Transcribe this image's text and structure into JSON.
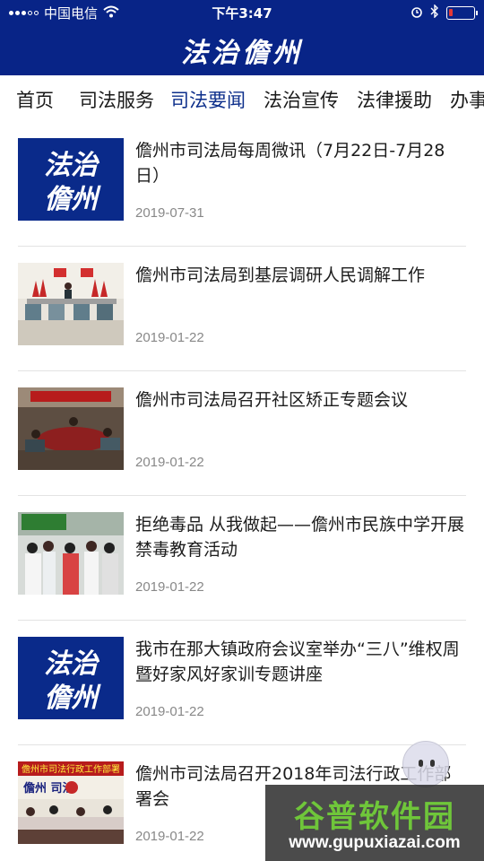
{
  "status_bar": {
    "carrier": "中国电信",
    "time": "下午3:47",
    "battery_level": 0.15,
    "battery_color": "#e53935"
  },
  "header": {
    "title": "法治儋州",
    "background_color": "#082487"
  },
  "tabs": [
    {
      "label": "首页",
      "active": false
    },
    {
      "label": "司法服务",
      "active": false
    },
    {
      "label": "司法要闻",
      "active": true
    },
    {
      "label": "法治宣传",
      "active": false
    },
    {
      "label": "法律援助",
      "active": false
    },
    {
      "label": "办事",
      "active": false
    }
  ],
  "accent_color": "#0d2f8b",
  "news": [
    {
      "title": "儋州市司法局每周微讯（7月22日-7月28日）",
      "date": "2019-07-31",
      "thumb": "logo"
    },
    {
      "title": "儋州市司法局到基层调研人民调解工作",
      "date": "2019-01-22",
      "thumb": "meeting-room"
    },
    {
      "title": "儋州市司法局召开社区矫正专题会议",
      "date": "2019-01-22",
      "thumb": "conference"
    },
    {
      "title": "拒绝毒品 从我做起——儋州市民族中学开展禁毒教育活动",
      "date": "2019-01-22",
      "thumb": "students"
    },
    {
      "title": "我市在那大镇政府会议室举办“三八”维权周暨好家风好家训专题讲座",
      "date": "2019-01-22",
      "thumb": "logo"
    },
    {
      "title": "儋州市司法局召开2018年司法行政工作部署会",
      "date": "2019-01-22",
      "thumb": "banner-meeting"
    }
  ],
  "thumb_logo_text": "法治儋州",
  "thumb_banner_text": "儋州市司法行政工作部署",
  "thumb_banner_sub": "儋州  司法",
  "watermark": {
    "main": "谷普软件园",
    "url": "www.gupuxiazai.com"
  }
}
